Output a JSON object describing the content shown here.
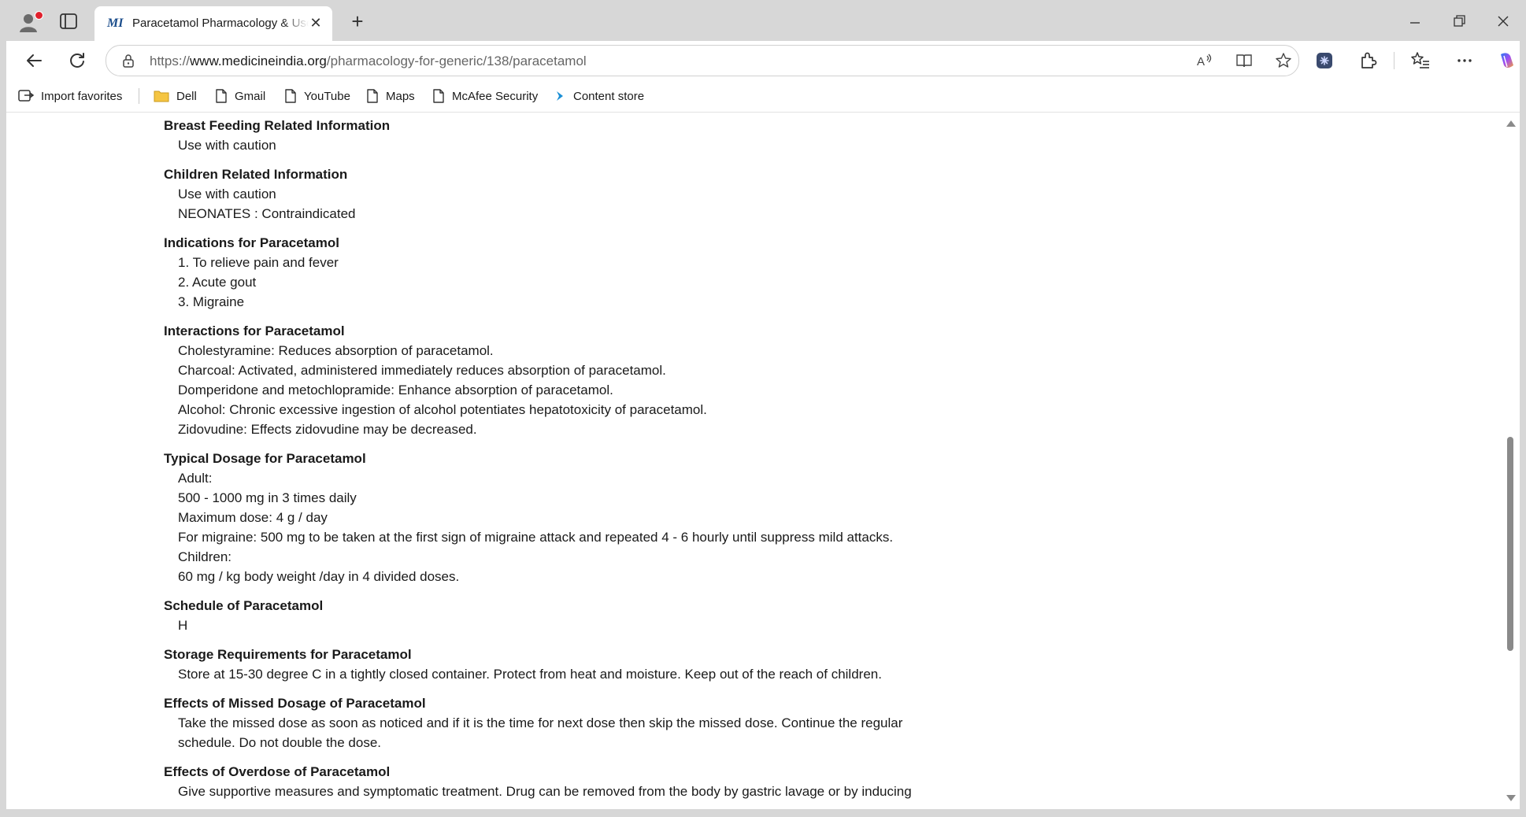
{
  "browser": {
    "tab": {
      "favicon_text": "MI",
      "title": "Paracetamol Pharmacology & Uses",
      "close_label": "✕"
    },
    "new_tab_label": "+",
    "url": {
      "scheme": "https://",
      "host": "www.medicineindia.org",
      "path": "/pharmacology-for-generic/138/paracetamol"
    },
    "favorites": [
      {
        "label": "Import favorites",
        "icon": "import-favorites-icon"
      },
      {
        "label": "Dell",
        "icon": "folder-icon"
      },
      {
        "label": "Gmail",
        "icon": "page-icon"
      },
      {
        "label": "YouTube",
        "icon": "page-icon"
      },
      {
        "label": "Maps",
        "icon": "page-icon"
      },
      {
        "label": "McAfee Security",
        "icon": "page-icon"
      },
      {
        "label": "Content store",
        "icon": "content-store-icon"
      }
    ],
    "colors": {
      "chrome": "#d7d7d7",
      "accent_red": "#e0202c",
      "favicon_blue": "#1c4e8c",
      "folder_yellow": "#f5c542"
    }
  },
  "article": {
    "sections": [
      {
        "heading": "Breast Feeding Related Information",
        "lines": [
          "Use with caution"
        ]
      },
      {
        "heading": "Children Related Information",
        "lines": [
          "Use with caution",
          "NEONATES : Contraindicated"
        ]
      },
      {
        "heading": "Indications for Paracetamol",
        "lines": [
          "1. To relieve pain and fever",
          "2. Acute gout",
          "3. Migraine"
        ]
      },
      {
        "heading": "Interactions for Paracetamol",
        "lines": [
          "Cholestyramine: Reduces absorption of paracetamol.",
          "Charcoal: Activated, administered immediately reduces absorption of paracetamol.",
          "Domperidone and metochlopramide: Enhance absorption of paracetamol.",
          "Alcohol: Chronic excessive ingestion of alcohol potentiates hepatotoxicity of paracetamol.",
          "Zidovudine: Effects zidovudine may be decreased."
        ]
      },
      {
        "heading": "Typical Dosage for Paracetamol",
        "lines": [
          "Adult:",
          "500 - 1000 mg in 3 times daily",
          "Maximum dose: 4 g / day",
          "For migraine: 500 mg to be taken at the first sign of migraine attack and repeated 4 - 6 hourly until suppress mild attacks.",
          "Children:",
          "60 mg / kg body weight /day in 4 divided doses."
        ]
      },
      {
        "heading": "Schedule of Paracetamol",
        "lines": [
          "H"
        ]
      },
      {
        "heading": "Storage Requirements for Paracetamol",
        "lines": [
          "Store at 15-30 degree C in a tightly closed container. Protect from heat and moisture. Keep out of the reach of children."
        ]
      },
      {
        "heading": "Effects of Missed Dosage of Paracetamol",
        "lines": [
          "Take the missed dose as soon as noticed and if it is the time for next dose then skip the missed dose. Continue the regular",
          "schedule. Do not double the dose."
        ]
      },
      {
        "heading": "Effects of Overdose of Paracetamol",
        "lines": [
          "Give supportive measures and symptomatic treatment. Drug can be removed from the body by gastric lavage or by inducing"
        ]
      }
    ]
  }
}
